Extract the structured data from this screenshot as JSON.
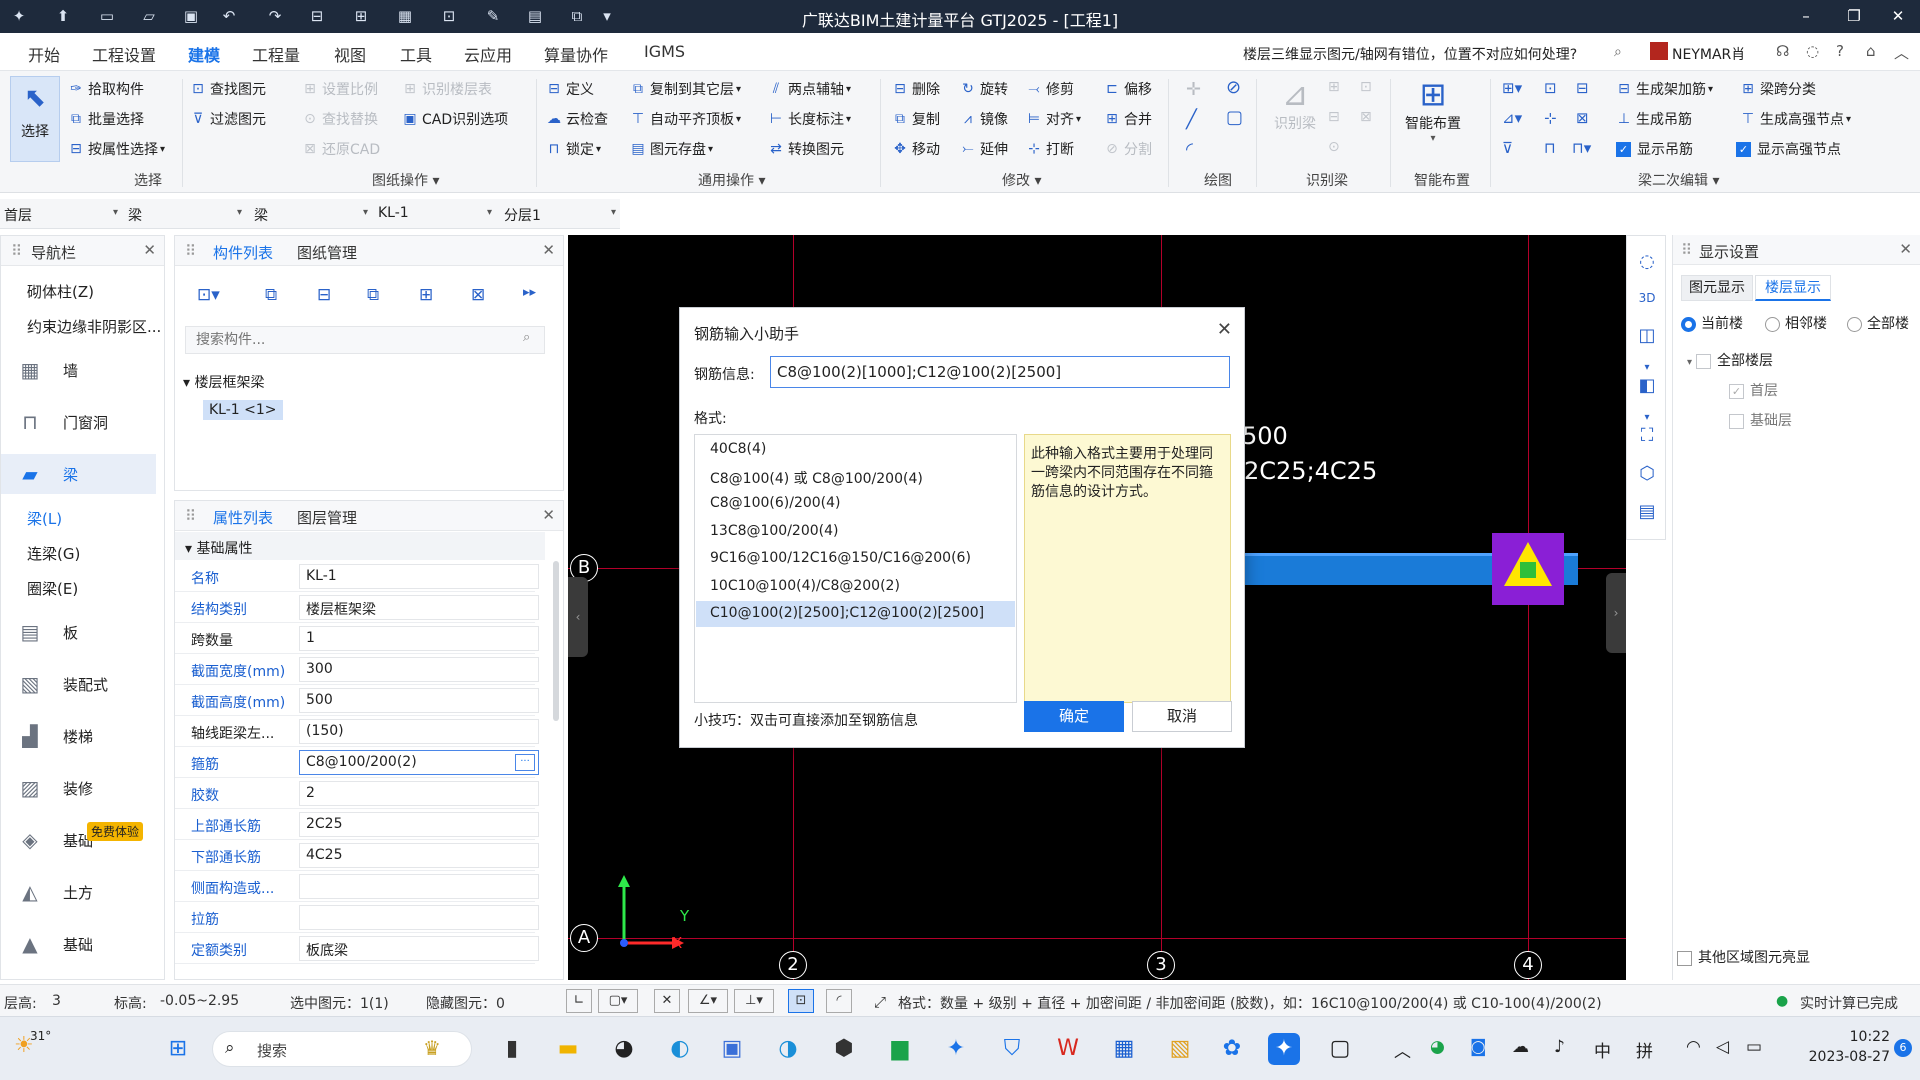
{
  "titlebar": {
    "title": "广联达BIM土建计量平台 GTJ2025 - [工程1]"
  },
  "menubar": {
    "items": [
      "开始",
      "工程设置",
      "建模",
      "工程量",
      "视图",
      "工具",
      "云应用",
      "算量协作",
      "IGMS"
    ],
    "help_question": "楼层三维显示图元/轴网有错位，位置不对应如何处理?",
    "user": "NEYMAR肖"
  },
  "ribbon": {
    "select": "选择",
    "pick": "拾取构件",
    "batch_select": "批量选择",
    "by_attr": "按属性选择",
    "select_group": "选择",
    "find": "查找图元",
    "filter": "过滤图元",
    "set_scale": "设置比例",
    "find_replace": "查找替换",
    "restore_cad": "还原CAD",
    "recognize_floor": "识别楼层表",
    "cad_options": "CAD识别选项",
    "drawing_group": "图纸操作",
    "define": "定义",
    "cloud_check": "云检查",
    "lock": "锁定",
    "copy_floor": "复制到其它层",
    "auto_align": "自动平齐顶板",
    "elem_save": "图元存盘",
    "two_point_axis": "两点辅轴",
    "length_mark": "长度标注",
    "convert": "转换图元",
    "general_group": "通用操作",
    "delete": "删除",
    "copy": "复制",
    "move": "移动",
    "rotate": "旋转",
    "mirror": "镜像",
    "extend": "延伸",
    "trim": "修剪",
    "align": "对齐",
    "break": "打断",
    "offset": "偏移",
    "merge": "合并",
    "split": "分割",
    "modify_group": "修改",
    "draw_group": "绘图",
    "recognize_beam": "识别梁",
    "recog_group": "识别梁",
    "smart_layout": "智能布置",
    "smart_group": "智能布置",
    "gen_add_rebar": "生成架加筋",
    "gen_hanger": "生成吊筋",
    "show_hanger": "显示吊筋",
    "beam_span_class": "梁跨分类",
    "gen_high_node": "生成高强节点",
    "show_high_node": "显示高强节点",
    "beam_edit_group": "梁二次编辑"
  },
  "floorbar": {
    "floor": "首层",
    "type": "梁",
    "sub": "梁",
    "component": "KL-1",
    "layer": "分层1"
  },
  "nav": {
    "title": "导航栏",
    "items": [
      {
        "label": "砌体柱(Z)"
      },
      {
        "label": "约束边缘非阴影区..."
      },
      {
        "label": "墙"
      },
      {
        "label": "门窗洞"
      },
      {
        "label": "梁"
      },
      {
        "label": "梁(L)"
      },
      {
        "label": "连梁(G)"
      },
      {
        "label": "圈梁(E)"
      },
      {
        "label": "板"
      },
      {
        "label": "装配式"
      },
      {
        "label": "楼梯"
      },
      {
        "label": "装修"
      },
      {
        "label": "基础"
      },
      {
        "label": "土方"
      },
      {
        "label": "基础"
      }
    ],
    "badge": "免费体验"
  },
  "complist": {
    "tab1": "构件列表",
    "tab2": "图纸管理",
    "search_placeholder": "搜索构件...",
    "group": "楼层框架梁",
    "item": "KL-1 <1>"
  },
  "props": {
    "tab1": "属性列表",
    "tab2": "图层管理",
    "section": "基础属性",
    "rows": [
      {
        "k": "名称",
        "v": "KL-1"
      },
      {
        "k": "结构类别",
        "v": "楼层框架梁"
      },
      {
        "k": "跨数量",
        "v": "1"
      },
      {
        "k": "截面宽度(mm)",
        "v": "300"
      },
      {
        "k": "截面高度(mm)",
        "v": "500"
      },
      {
        "k": "轴线距梁左...",
        "v": "(150)"
      },
      {
        "k": "箍筋",
        "v": "C8@100/200(2)"
      },
      {
        "k": "胶数",
        "v": "2"
      },
      {
        "k": "上部通长筋",
        "v": "2C25"
      },
      {
        "k": "下部通长筋",
        "v": "4C25"
      },
      {
        "k": "侧面构造或...",
        "v": ""
      },
      {
        "k": "拉筋",
        "v": ""
      },
      {
        "k": "定额类别",
        "v": "板底梁"
      }
    ]
  },
  "canvas": {
    "text1": "500",
    "text2": "2C25;4C25",
    "axes_top": [
      "2",
      "3",
      "4"
    ],
    "axes_left": [
      "B",
      "A"
    ],
    "x_axis": "X",
    "y_axis": "Y"
  },
  "dialog": {
    "title": "钢筋输入小助手",
    "info_label": "钢筋信息:",
    "info_value": "C8@100(2)[1000];C12@100(2)[2500]",
    "format_label": "格式:",
    "formats": [
      "40C8(4)",
      "C8@100(4) 或 C8@100/200(4)",
      "C8@100(6)/200(4)",
      "13C8@100/200(4)",
      "9C16@100/12C16@150/C16@200(6)",
      "10C10@100(4)/C8@200(2)",
      "C10@100(2)[2500];C12@100(2)[2500]"
    ],
    "hint": "此种输入格式主要用于处理同一跨梁内不同范围存在不同箍筋信息的设计方式。",
    "tip": "小技巧：双击可直接添加至钢筋信息",
    "ok": "确定",
    "cancel": "取消"
  },
  "display": {
    "title": "显示设置",
    "tab1": "图元显示",
    "tab2": "楼层显示",
    "r1": "当前楼",
    "r2": "相邻楼",
    "r3": "全部楼",
    "all_floors": "全部楼层",
    "floor1": "首层",
    "floor0": "基础层",
    "other_area": "其他区域图元亮显"
  },
  "status": {
    "height_lbl": "层高:",
    "height": "3",
    "elev_lbl": "标高:",
    "elev": "-0.05~2.95",
    "selected": "选中图元：1(1)",
    "hidden": "隐藏图元：0",
    "format_hint": "格式：数量 + 级别 + 直径 + 加密间距 / 非加密间距 (胶数)，如：16C10@100/200(4) 或 C10-100(4)/200(2)",
    "realtime": "实时计算已完成"
  },
  "taskbar": {
    "temp": "31°",
    "search": "搜索",
    "time": "10:22",
    "date": "2023-08-27",
    "ime1": "中",
    "ime2": "拼",
    "notif": "6"
  }
}
